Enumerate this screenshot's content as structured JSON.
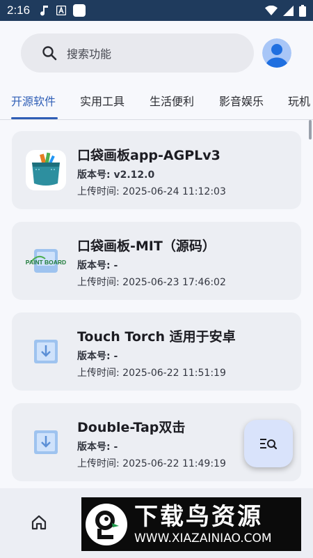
{
  "status_bar": {
    "time": "2:16",
    "left_icons": [
      "music-note-icon",
      "a-icon",
      "square-icon"
    ],
    "right_icons": [
      "wifi-icon",
      "signal-icon",
      "battery-icon"
    ]
  },
  "search": {
    "placeholder": "搜索功能",
    "icon": "search-icon"
  },
  "tabs": [
    {
      "label": "开源软件",
      "active": true
    },
    {
      "label": "实用工具"
    },
    {
      "label": "生活便利"
    },
    {
      "label": "影音娱乐"
    },
    {
      "label": "玩机"
    }
  ],
  "apps": [
    {
      "title": "口袋画板app-AGPLv3",
      "version_label": "版本号:",
      "version": "v2.12.0",
      "time_label": "上传时间:",
      "time": "2025-06-24 11:12:03"
    },
    {
      "title": "口袋画板-MIT（源码）",
      "version_label": "版本号:",
      "version": "-",
      "time_label": "上传时间:",
      "time": "2025-06-23 17:46:02",
      "icon_text": "PAINT BOARD"
    },
    {
      "title": "Touch Torch 适用于安卓",
      "version_label": "版本号:",
      "version": "-",
      "time_label": "上传时间:",
      "time": "2025-06-22 11:51:19"
    },
    {
      "title": "Double-Tap双击",
      "version_label": "版本号:",
      "version": "-",
      "time_label": "上传时间:",
      "time": "2025-06-22 11:49:19"
    }
  ],
  "watermark": {
    "title": "下载鸟资源",
    "url": "WWW.XIAZAINIAO.COM"
  },
  "colors": {
    "status_bar": "#1f3b5d",
    "accent": "#2f5eb6",
    "card_bg": "#eceef3",
    "fab_bg": "#d9e3fb"
  }
}
